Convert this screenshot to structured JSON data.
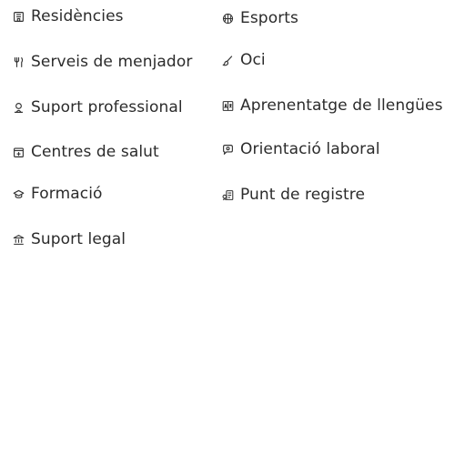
{
  "services": {
    "left": [
      {
        "label": "Residències",
        "icon": "building-icon"
      },
      {
        "label": "Serveis de menjador",
        "icon": "fork-knife-icon"
      },
      {
        "label": "Suport professional",
        "icon": "person-support-icon"
      },
      {
        "label": "Centres de salut",
        "icon": "medical-plus-icon"
      },
      {
        "label": "Formació",
        "icon": "graduation-cap-icon"
      },
      {
        "label": "Suport legal",
        "icon": "courthouse-icon"
      }
    ],
    "right": [
      {
        "label": "Esports",
        "icon": "basketball-icon"
      },
      {
        "label": "Oci",
        "icon": "paintbrush-icon"
      },
      {
        "label": "Aprenentatge de llengües",
        "icon": "language-icon"
      },
      {
        "label": "Orientació laboral",
        "icon": "speech-bubble-icon"
      },
      {
        "label": "Punt de registre",
        "icon": "registration-icon"
      }
    ]
  }
}
